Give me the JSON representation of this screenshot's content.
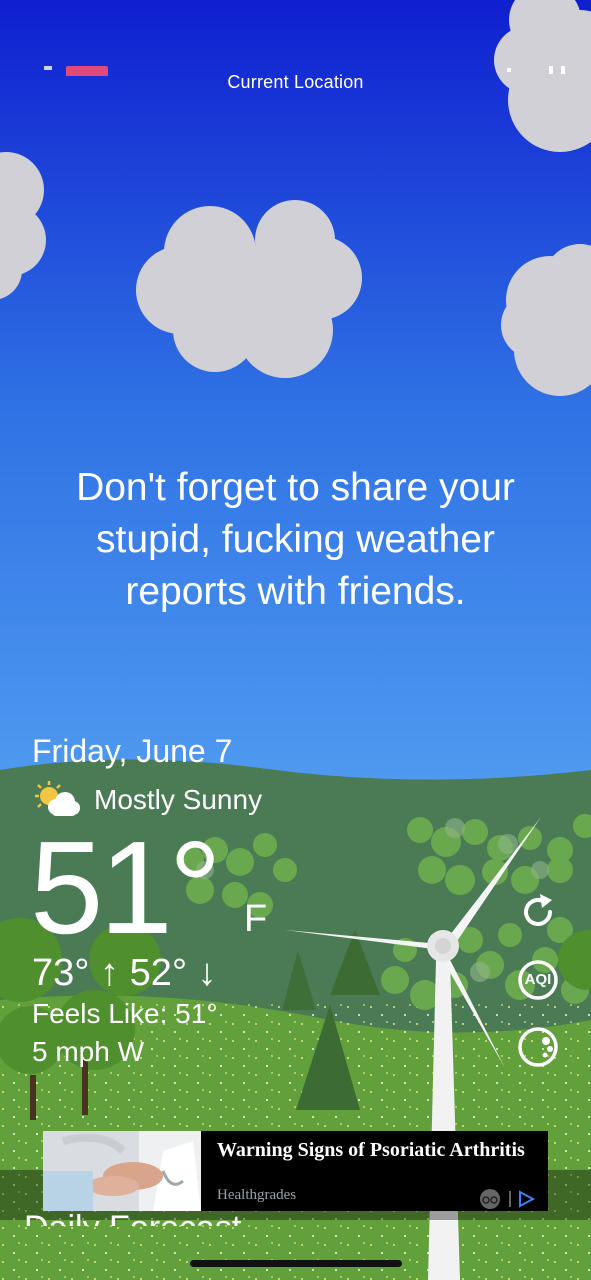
{
  "header": {
    "location": "Current Location"
  },
  "message": {
    "tagline": "Don't forget to share your stupid, fucking weather reports with friends."
  },
  "current": {
    "date": "Friday, June 7",
    "condition": "Mostly Sunny",
    "condition_icon": "partly-sunny-icon",
    "temperature": "51°",
    "unit": "F",
    "hi_lo": "73° ↑ 52° ↓",
    "feels_like": "Feels Like: 51°",
    "wind": "5 mph W"
  },
  "actions": {
    "refresh_icon": "refresh-icon",
    "aqi_label": "AQI",
    "radar_icon": "radar-icon"
  },
  "ad": {
    "title": "Warning Signs of Psoriatic Arthritis",
    "source": "Healthgrades",
    "adchoices_icon": "adchoices-icon"
  },
  "section": {
    "daily_title": "Daily Forecast"
  },
  "colors": {
    "sky_top": "#0f1fd0",
    "sky_bottom": "#5aa6f4",
    "hill_far": "#49754f",
    "grass": "#5f9a38",
    "cloud": "#d0d0d6"
  }
}
